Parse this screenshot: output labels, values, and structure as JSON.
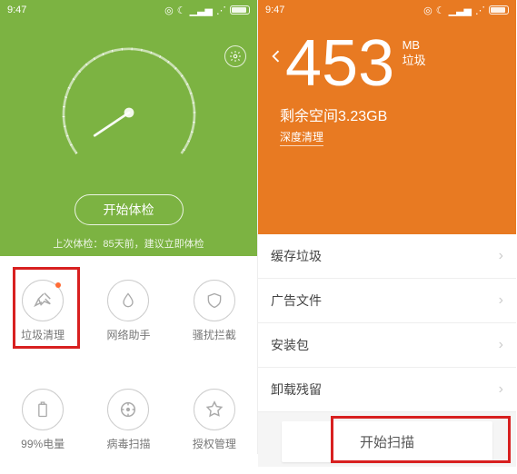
{
  "status": {
    "time": "9:47"
  },
  "left": {
    "start_button": "开始体检",
    "last_check": "上次体检：85天前，建议立即体检",
    "grid": [
      {
        "label": "垃圾清理",
        "icon": "broom"
      },
      {
        "label": "网络助手",
        "icon": "drop"
      },
      {
        "label": "骚扰拦截",
        "icon": "shield"
      },
      {
        "label": "99%电量",
        "icon": "battery"
      },
      {
        "label": "病毒扫描",
        "icon": "target"
      },
      {
        "label": "授权管理",
        "icon": "star"
      }
    ]
  },
  "right": {
    "value": "453",
    "unit_top": "MB",
    "unit_bottom": "垃圾",
    "space_prefix": "剩余空间",
    "space_value": "3.23GB",
    "deep_clean": "深度清理",
    "items": [
      "缓存垃圾",
      "广告文件",
      "安装包",
      "卸载残留"
    ],
    "scan_button": "开始扫描"
  }
}
